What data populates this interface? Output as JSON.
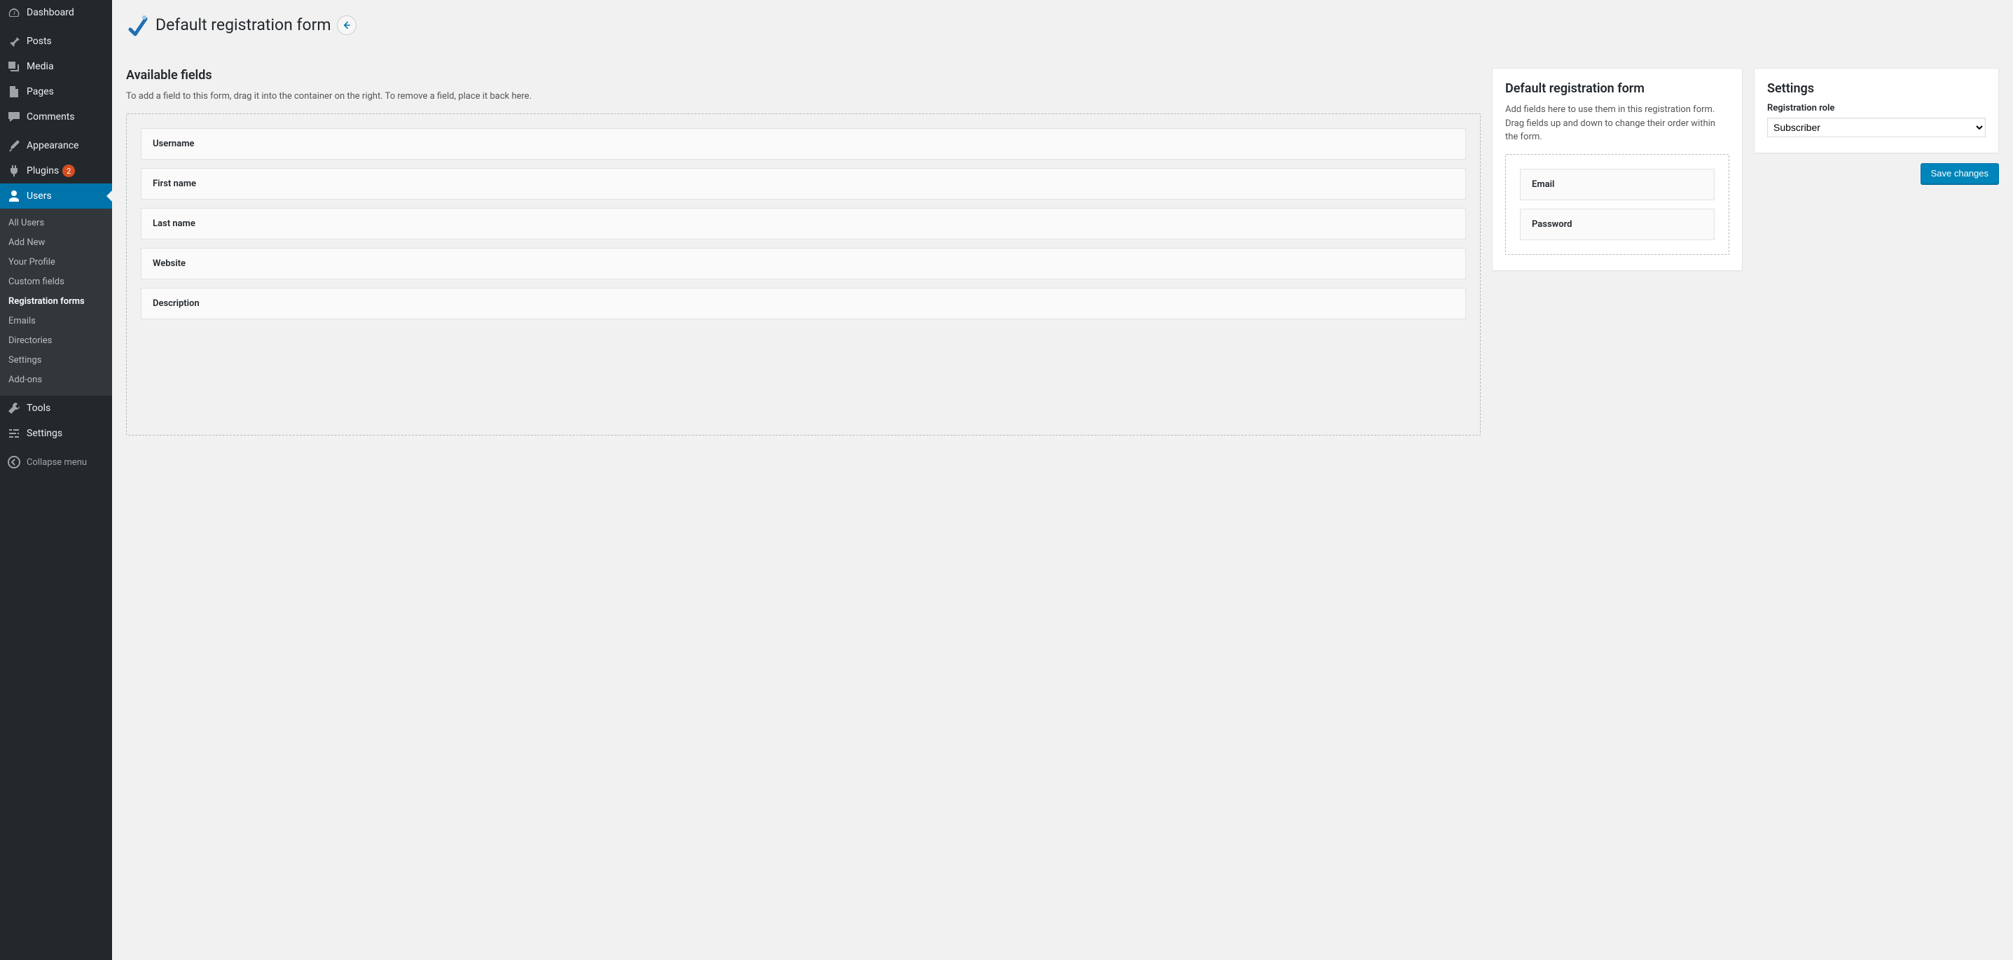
{
  "sidebar": {
    "menu": [
      {
        "id": "dashboard",
        "label": "Dashboard",
        "icon": "dashboard-icon"
      },
      {
        "id": "posts",
        "label": "Posts",
        "icon": "pin-icon"
      },
      {
        "id": "media",
        "label": "Media",
        "icon": "media-icon"
      },
      {
        "id": "pages",
        "label": "Pages",
        "icon": "page-icon"
      },
      {
        "id": "comments",
        "label": "Comments",
        "icon": "comment-icon"
      },
      {
        "id": "appearance",
        "label": "Appearance",
        "icon": "brush-icon"
      },
      {
        "id": "plugins",
        "label": "Plugins",
        "icon": "plug-icon",
        "badge": "2"
      },
      {
        "id": "users",
        "label": "Users",
        "icon": "user-icon",
        "current": true
      },
      {
        "id": "tools",
        "label": "Tools",
        "icon": "wrench-icon"
      },
      {
        "id": "settings",
        "label": "Settings",
        "icon": "sliders-icon"
      }
    ],
    "submenu_users": [
      {
        "id": "all-users",
        "label": "All Users"
      },
      {
        "id": "add-new",
        "label": "Add New"
      },
      {
        "id": "your-profile",
        "label": "Your Profile"
      },
      {
        "id": "custom-fields",
        "label": "Custom fields"
      },
      {
        "id": "reg-forms",
        "label": "Registration forms",
        "active": true
      },
      {
        "id": "emails",
        "label": "Emails"
      },
      {
        "id": "directories",
        "label": "Directories"
      },
      {
        "id": "settings",
        "label": "Settings"
      },
      {
        "id": "add-ons",
        "label": "Add-ons"
      }
    ],
    "collapse_label": "Collapse menu"
  },
  "header": {
    "title": "Default registration form"
  },
  "available": {
    "title": "Available fields",
    "desc": "To add a field to this form, drag it into the container on the right. To remove a field, place it back here.",
    "fields": [
      "Username",
      "First name",
      "Last name",
      "Website",
      "Description"
    ]
  },
  "form": {
    "title": "Default registration form",
    "desc": "Add fields here to use them in this registration form. Drag fields up and down to change their order within the form.",
    "fields": [
      "Email",
      "Password"
    ]
  },
  "settings": {
    "title": "Settings",
    "role_label": "Registration role",
    "role_value": "Subscriber",
    "save_label": "Save changes"
  }
}
